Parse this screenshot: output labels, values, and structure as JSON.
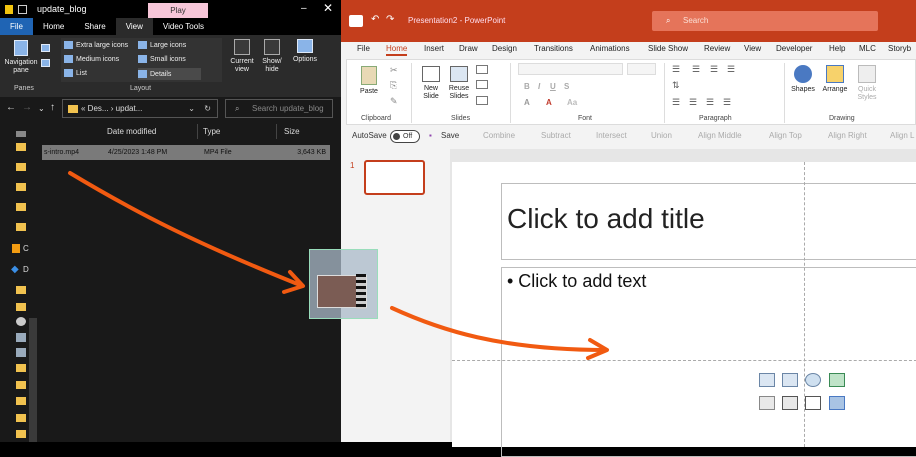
{
  "explorer": {
    "title": "update_blog",
    "play_tab": "Play",
    "tabs": [
      "File",
      "Home",
      "Share",
      "View",
      "Video Tools"
    ],
    "ribbon": {
      "navigation_pane": "Navigation pane",
      "panes_label": "Panes",
      "layout_label": "Layout",
      "layout_options": [
        "Extra large icons",
        "Large icons",
        "Medium icons",
        "Small icons",
        "List",
        "Details"
      ],
      "current_view": "Current view",
      "show_hide": "Show/ hide",
      "options": "Options"
    },
    "address": {
      "path": "« Des... › updat...",
      "search_placeholder": "Search update_blog"
    },
    "columns": [
      "Date modified",
      "Type",
      "Size"
    ],
    "files": [
      {
        "name": "s-intro.mp4",
        "date": "4/25/2023 1:48 PM",
        "type": "MP4 File",
        "size": "3,643 KB"
      }
    ],
    "nav_labels": [
      "C",
      "D"
    ]
  },
  "ppt": {
    "app_title": "Presentation2 - PowerPoint",
    "search_placeholder": "Search",
    "tabs": [
      "File",
      "Home",
      "Insert",
      "Draw",
      "Design",
      "Transitions",
      "Animations",
      "Slide Show",
      "Review",
      "View",
      "Developer",
      "Help",
      "MLC",
      "Storyb"
    ],
    "active_tab": "Home",
    "ribbon": {
      "paste": "Paste",
      "clipboard": "Clipboard",
      "new_slide": "New Slide",
      "reuse_slides": "Reuse Slides",
      "slides": "Slides",
      "font": "Font",
      "paragraph": "Paragraph",
      "shapes": "Shapes",
      "arrange": "Arrange",
      "quick_styles": "Quick Styles",
      "drawing": "Drawing"
    },
    "qat": {
      "autosave": "AutoSave",
      "toggle": "Off",
      "items": [
        "Save",
        "Combine",
        "Subtract",
        "Intersect",
        "Union",
        "Align Middle",
        "Align Top",
        "Align Right",
        "Align L"
      ]
    },
    "slide_number": "1",
    "title_placeholder": "Click to add title",
    "body_placeholder": "• Click to add text"
  }
}
